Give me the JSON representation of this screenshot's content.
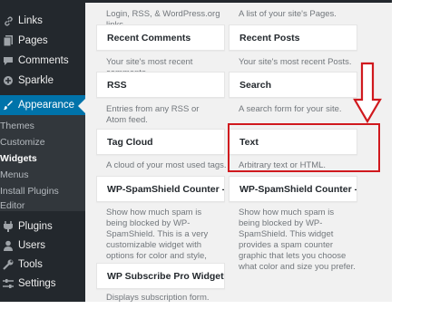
{
  "sidebar": {
    "items": [
      {
        "label": "Links",
        "icon": "link-icon"
      },
      {
        "label": "Pages",
        "icon": "pages-icon"
      },
      {
        "label": "Comments",
        "icon": "comment-icon"
      },
      {
        "label": "Sparkle",
        "icon": "sparkle-icon"
      },
      {
        "label": "Appearance",
        "icon": "paintbrush-icon"
      },
      {
        "label": "Plugins",
        "icon": "plugin-icon"
      },
      {
        "label": "Users",
        "icon": "users-icon"
      },
      {
        "label": "Tools",
        "icon": "wrench-icon"
      },
      {
        "label": "Settings",
        "icon": "settings-icon"
      }
    ],
    "submenu": [
      "Themes",
      "Customize",
      "Widgets",
      "Menus",
      "Install Plugins",
      "Editor"
    ]
  },
  "widgets": {
    "top_left_desc": "Login, RSS, & WordPress.org links.",
    "top_right_desc": "A list of your site's Pages.",
    "recent_comments": {
      "title": "Recent Comments",
      "desc": "Your site's most recent comments."
    },
    "recent_posts": {
      "title": "Recent Posts",
      "desc": "Your site's most recent Posts."
    },
    "rss": {
      "title": "RSS",
      "desc": "Entries from any RSS or Atom feed."
    },
    "search": {
      "title": "Search",
      "desc": "A search form for your site."
    },
    "tag_cloud": {
      "title": "Tag Cloud",
      "desc": "A cloud of your most used tags."
    },
    "text": {
      "title": "Text",
      "desc": "Arbitrary text or HTML."
    },
    "spam_counter_1": {
      "title": "WP-SpamShield Counter - Cu…",
      "desc": "Show how much spam is being blocked by WP-SpamShield. This is a very customizable widget with options for color and style, including a custom color chooser."
    },
    "spam_counter_2": {
      "title": "WP-SpamShield Counter - Gr…",
      "desc": "Show how much spam is being blocked by WP-SpamShield. This widget provides a spam counter graphic that lets you choose what color and size you prefer."
    },
    "subscribe": {
      "title": "WP Subscribe Pro Widget",
      "desc": "Displays subscription form."
    }
  },
  "colors": {
    "sidebar_bg": "#23282d",
    "active_bg": "#0073aa",
    "annotation_red": "#d0191e"
  }
}
